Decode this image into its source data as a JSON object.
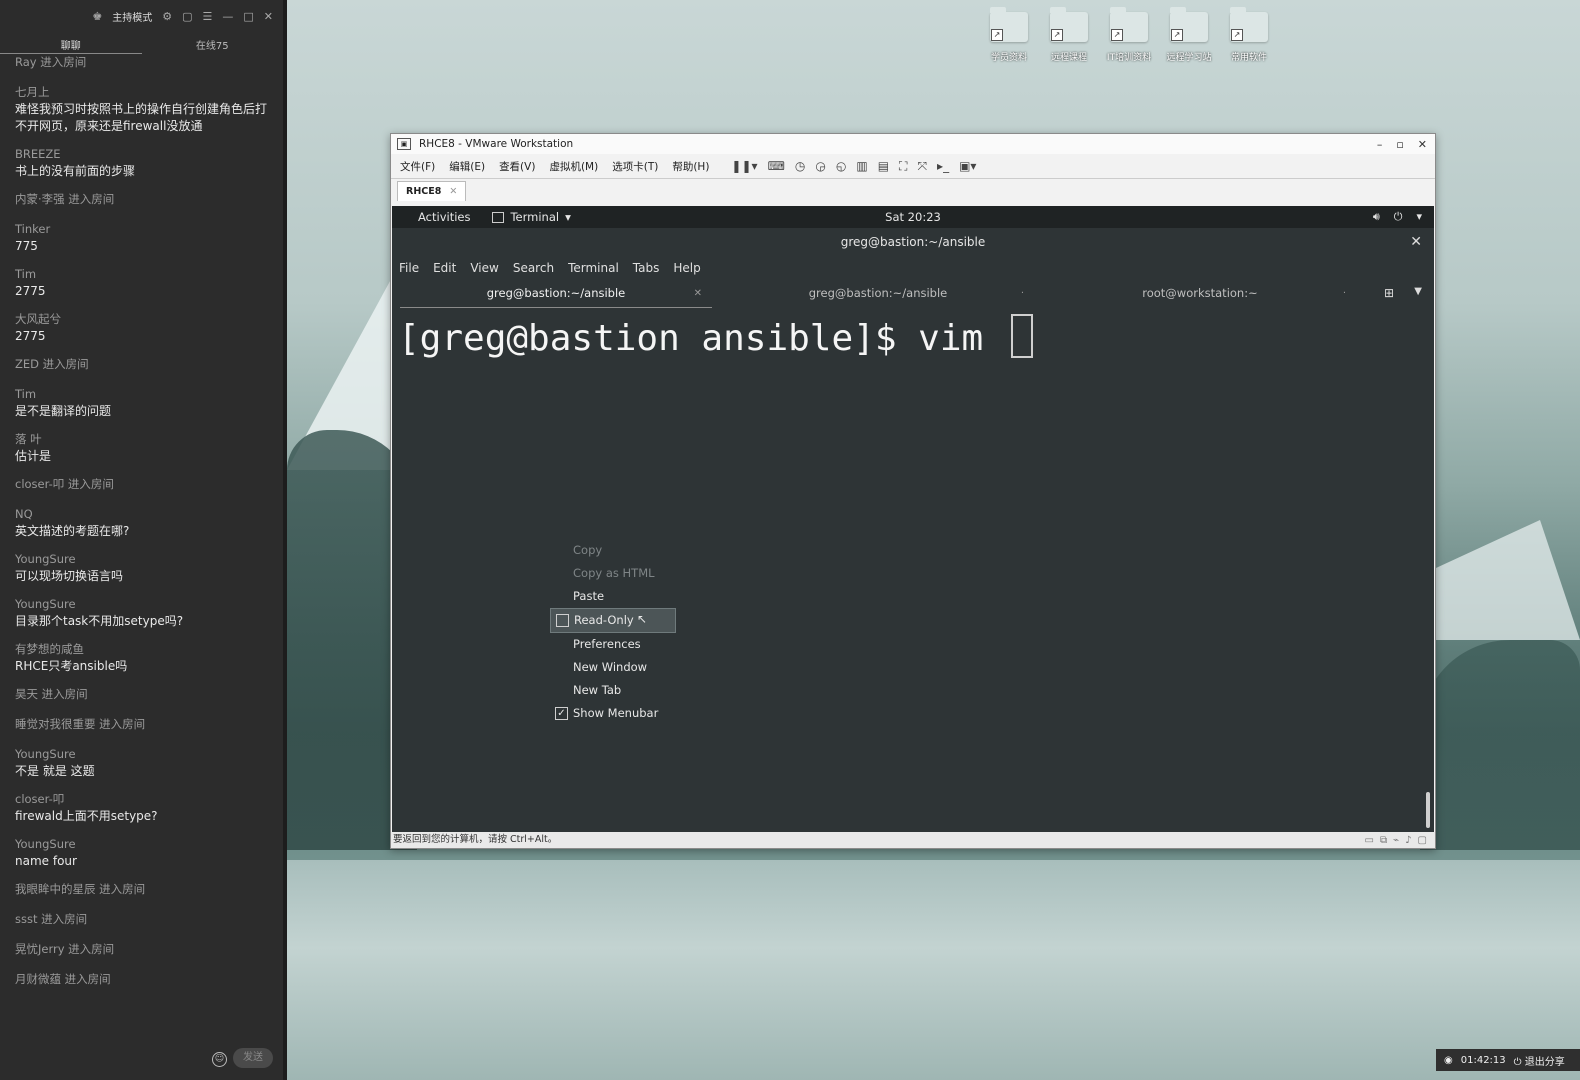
{
  "chat": {
    "header_title": "主持模式",
    "tabs": [
      "聊聊",
      "在线75"
    ],
    "messages": [
      {
        "kind": "sys",
        "text": "Ray 进入房间"
      },
      {
        "kind": "msg",
        "name": "七月上",
        "text": "难怪我预习时按照书上的操作自行创建角色后打不开网页，原来还是firewall没放通"
      },
      {
        "kind": "msg",
        "name": "BREEZE",
        "text": "书上的没有前面的步骤"
      },
      {
        "kind": "sys",
        "text": "内蒙·李强 进入房间"
      },
      {
        "kind": "msg",
        "name": "Tinker",
        "text": "775"
      },
      {
        "kind": "msg",
        "name": "Tim",
        "text": "2775"
      },
      {
        "kind": "msg",
        "name": "大风起兮",
        "text": "2775"
      },
      {
        "kind": "sys",
        "text": "ZED 进入房间"
      },
      {
        "kind": "msg",
        "name": "Tim",
        "text": "是不是翻译的问题"
      },
      {
        "kind": "msg",
        "name": "落 叶",
        "text": "估计是"
      },
      {
        "kind": "sys",
        "text": "closer-叩 进入房间"
      },
      {
        "kind": "msg",
        "name": "NQ",
        "text": "英文描述的考题在哪?"
      },
      {
        "kind": "msg",
        "name": "YoungSure",
        "text": "可以现场切换语言吗"
      },
      {
        "kind": "msg",
        "name": "YoungSure",
        "text": "目录那个task不用加setype吗?"
      },
      {
        "kind": "msg",
        "name": "有梦想的咸鱼",
        "text": "RHCE只考ansible吗"
      },
      {
        "kind": "sys",
        "text": "昊天 进入房间"
      },
      {
        "kind": "sys",
        "text": "睡觉对我很重要 进入房间"
      },
      {
        "kind": "msg",
        "name": "YoungSure",
        "text": "不是  就是 这题"
      },
      {
        "kind": "msg",
        "name": "closer-叩",
        "text": "firewald上面不用setype?"
      },
      {
        "kind": "msg",
        "name": "YoungSure",
        "text": "name four"
      },
      {
        "kind": "sys",
        "text": "我眼眸中的星辰 进入房间"
      },
      {
        "kind": "sys",
        "text": "ssst 进入房间"
      },
      {
        "kind": "sys",
        "text": "晃忧Jerry 进入房间"
      },
      {
        "kind": "sys",
        "text": "月财微蕴 进入房间"
      }
    ],
    "send_label": "发送"
  },
  "desktop_icons": [
    "学员资料",
    "远程课程",
    "IT培训资料",
    "远程学习站",
    "常用软件"
  ],
  "vmware": {
    "title": "RHCE8 - VMware Workstation",
    "menu": [
      "文件(F)",
      "编辑(E)",
      "查看(V)",
      "虚拟机(M)",
      "选项卡(T)",
      "帮助(H)"
    ],
    "tab_label": "RHCE8",
    "status_text": "要返回到您的计算机，请按 Ctrl+Alt。"
  },
  "gnome": {
    "activities": "Activities",
    "app_name": "Terminal",
    "clock": "Sat 20:23"
  },
  "terminal": {
    "window_title": "greg@bastion:~/ansible",
    "menu": [
      "File",
      "Edit",
      "View",
      "Search",
      "Terminal",
      "Tabs",
      "Help"
    ],
    "tabs": [
      "greg@bastion:~/ansible",
      "greg@bastion:~/ansible",
      "root@workstation:~"
    ],
    "prompt_line": "[greg@bastion ansible]$ vim "
  },
  "context_menu": {
    "items": [
      {
        "label": "Copy",
        "state": "disabled"
      },
      {
        "label": "Copy as HTML",
        "state": "disabled"
      },
      {
        "label": "Paste",
        "state": "normal"
      },
      {
        "label": "Read-Only",
        "state": "hover-unchecked"
      },
      {
        "label": "Preferences",
        "state": "normal"
      },
      {
        "label": "New Window",
        "state": "normal"
      },
      {
        "label": "New Tab",
        "state": "normal"
      },
      {
        "label": "Show Menubar",
        "state": "checked"
      }
    ]
  },
  "share_bar": {
    "timer": "01:42:13",
    "exit_label": "退出分享"
  }
}
